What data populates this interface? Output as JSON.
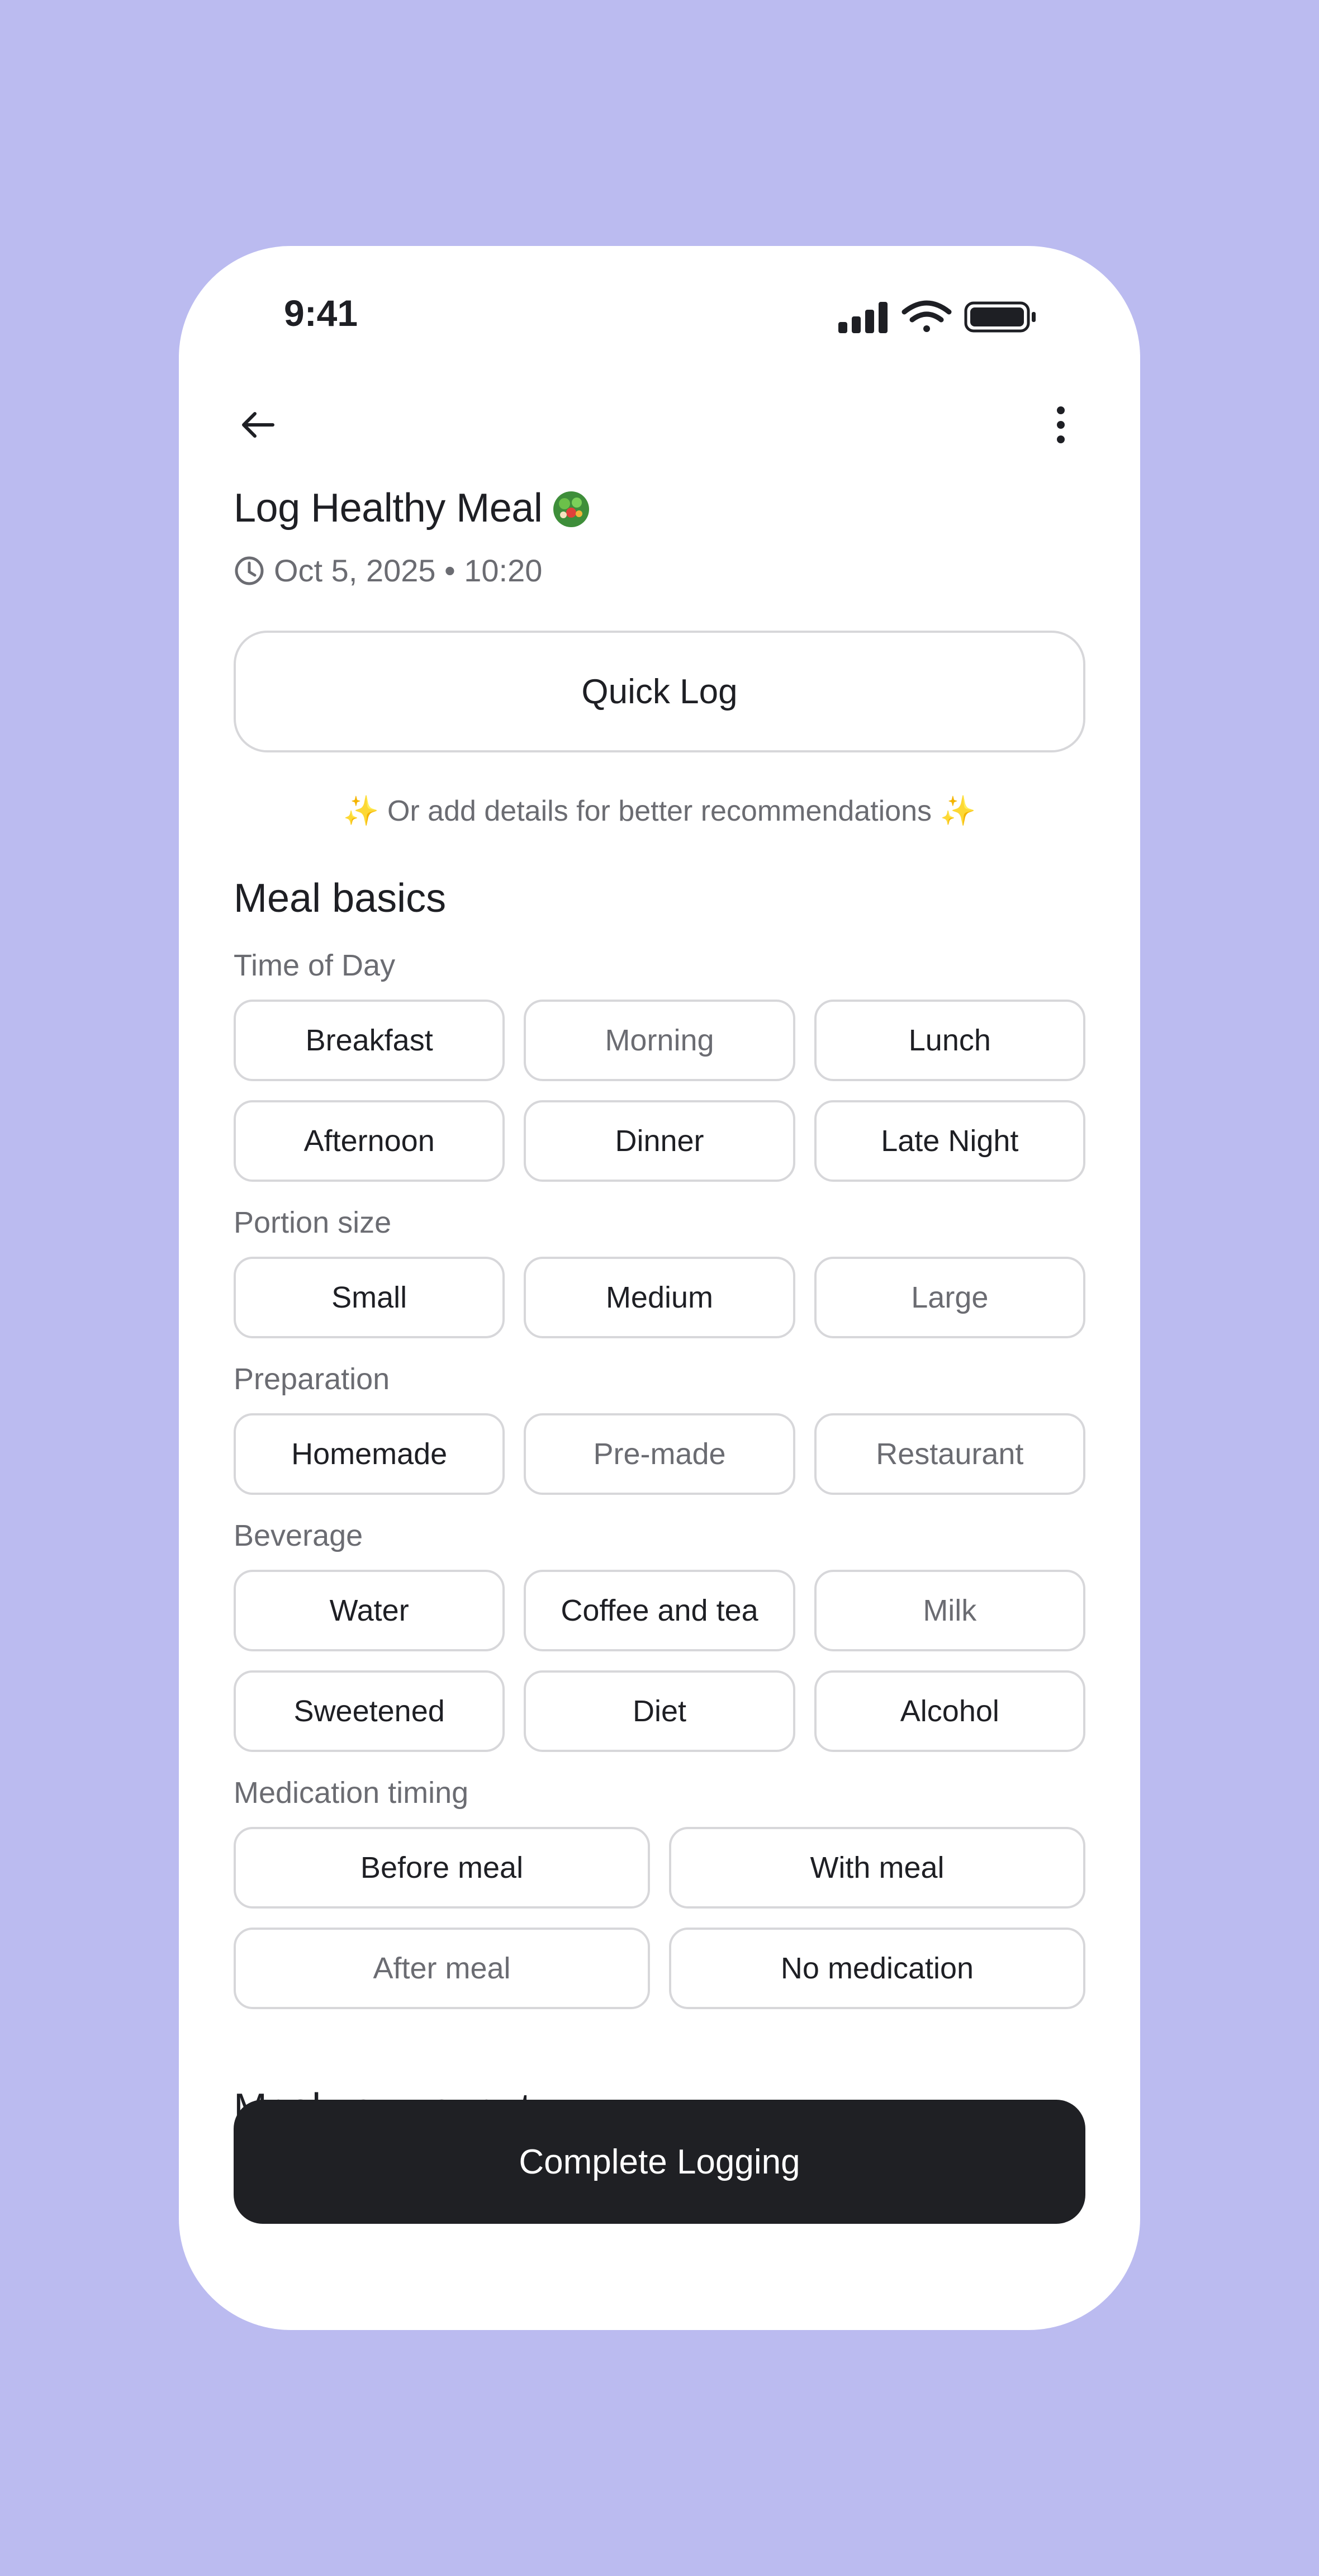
{
  "status_bar": {
    "time": "9:41",
    "icons": [
      "signal-icon",
      "wifi-icon",
      "battery-icon"
    ]
  },
  "header": {
    "back_icon": "arrow-left-icon",
    "more_icon": "more-vertical-icon",
    "title": "Log Healthy Meal",
    "title_emoji": "salad-emoji",
    "date_icon": "clock-icon",
    "date": "Oct 5, 2025 • 10:20"
  },
  "quick_log": {
    "label": "Quick Log"
  },
  "hint": {
    "text": "Or add details for better recommendations",
    "spark_left": "✨",
    "spark_right": "✨"
  },
  "meal_basics": {
    "title": "Meal basics",
    "groups": [
      {
        "label": "Time of Day",
        "options": [
          {
            "label": "Breakfast",
            "muted": false
          },
          {
            "label": "Morning",
            "muted": true
          },
          {
            "label": "Lunch",
            "muted": false
          },
          {
            "label": "Afternoon",
            "muted": false
          },
          {
            "label": "Dinner",
            "muted": false
          },
          {
            "label": "Late Night",
            "muted": false
          }
        ]
      },
      {
        "label": "Portion size",
        "options": [
          {
            "label": "Small",
            "muted": false
          },
          {
            "label": "Medium",
            "muted": false
          },
          {
            "label": "Large",
            "muted": true
          }
        ]
      },
      {
        "label": "Preparation",
        "options": [
          {
            "label": "Homemade",
            "muted": false
          },
          {
            "label": "Pre-made",
            "muted": true
          },
          {
            "label": "Restaurant",
            "muted": true
          }
        ]
      },
      {
        "label": "Beverage",
        "options": [
          {
            "label": "Water",
            "muted": false
          },
          {
            "label": "Coffee and tea",
            "muted": false
          },
          {
            "label": "Milk",
            "muted": true
          },
          {
            "label": "Sweetened",
            "muted": false
          },
          {
            "label": "Diet",
            "muted": false
          },
          {
            "label": "Alcohol",
            "muted": false
          }
        ]
      },
      {
        "label": "Medication timing",
        "options": [
          {
            "label": "Before meal",
            "muted": false
          },
          {
            "label": "With meal",
            "muted": false
          },
          {
            "label": "After meal",
            "muted": true
          },
          {
            "label": "No medication",
            "muted": false
          }
        ]
      }
    ]
  },
  "next_section": {
    "title": "Meal components"
  },
  "footer": {
    "complete_label": "Complete Logging"
  },
  "colors": {
    "background": "#BBBBF0",
    "card": "#FFFFFF",
    "text_primary": "#1E1F24",
    "text_secondary": "#6B6C72",
    "border": "#D7D7DA",
    "button_dark": "#1F2024",
    "sparkle": "#F4C542"
  }
}
